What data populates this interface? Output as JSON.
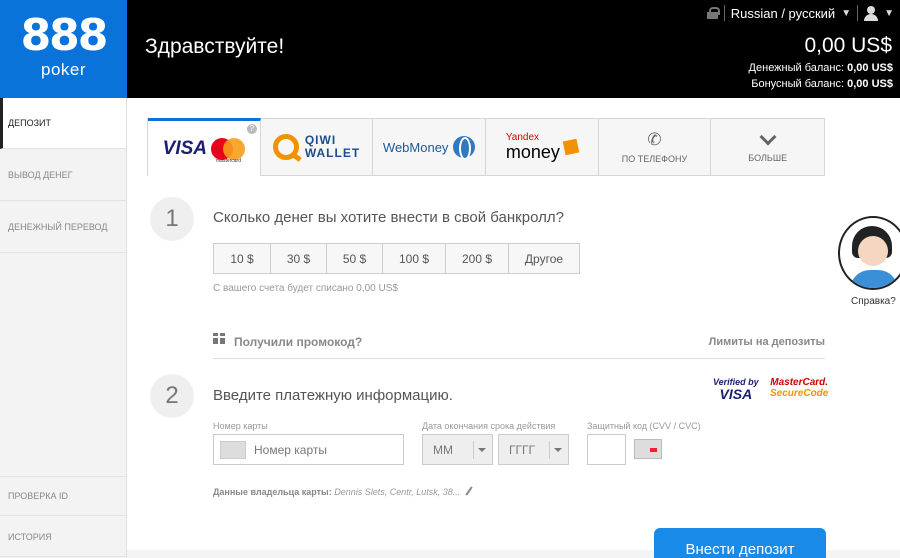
{
  "header": {
    "logo_number": "888",
    "logo_brand": "poker",
    "greeting": "Здравствуйте!",
    "language": "Russian / русский",
    "balance": "0,00 US$",
    "cash_balance_label": "Денежный баланс:",
    "cash_balance_value": "0,00 US$",
    "bonus_balance_label": "Бонусный баланс:",
    "bonus_balance_value": "0,00 US$"
  },
  "sidebar": {
    "items": [
      {
        "label": "ДЕПОЗИТ"
      },
      {
        "label": "ВЫВОД ДЕНЕГ"
      },
      {
        "label": "ДЕНЕЖНЫЙ ПЕРЕВОД"
      },
      {
        "label": "ПРОВЕРКА ID"
      },
      {
        "label": "ИСТОРИЯ"
      }
    ]
  },
  "tabs": {
    "visa": "VISA",
    "mastercard": "mastercard",
    "info": "?",
    "qiwi_line1": "QIWI",
    "qiwi_line2": "WALLET",
    "webmoney": "WebMoney",
    "yandex_line1": "Yandex",
    "yandex_line2": "money",
    "phone": "ПО ТЕЛЕФОНУ",
    "more": "БОЛЬШЕ"
  },
  "step1": {
    "number": "1",
    "question": "Сколько денег вы хотите внести в свой банкролл?",
    "amounts": [
      "10 $",
      "30 $",
      "50 $",
      "100 $",
      "200 $",
      "Другое"
    ],
    "charge_note": "С вашего счета будет списано 0,00 US$"
  },
  "promo": {
    "label": "Получили промокод?",
    "limits": "Лимиты на депозиты"
  },
  "step2": {
    "number": "2",
    "heading": "Введите платежную информацию.",
    "verified_line1": "Verified by",
    "verified_line2": "VISA",
    "securecode_line1": "MasterCard.",
    "securecode_line2": "SecureCode",
    "card_label": "Номер карты",
    "card_placeholder": "Номер карты",
    "expiry_label": "Дата окончания срока действия",
    "month_value": "MM",
    "year_value": "ГГГГ",
    "cvv_label": "Защитный код (CVV / CVC)",
    "owner_label": "Данные владельца карты:",
    "owner_value": "Dennis Slets, Centr, Lutsk, 38..."
  },
  "deposit_button": "Внести депозит",
  "help_label": "Справка?",
  "colors": {
    "brand_blue": "#0a73d9",
    "button_blue": "#1a8ae8",
    "header_bg": "#000000"
  }
}
